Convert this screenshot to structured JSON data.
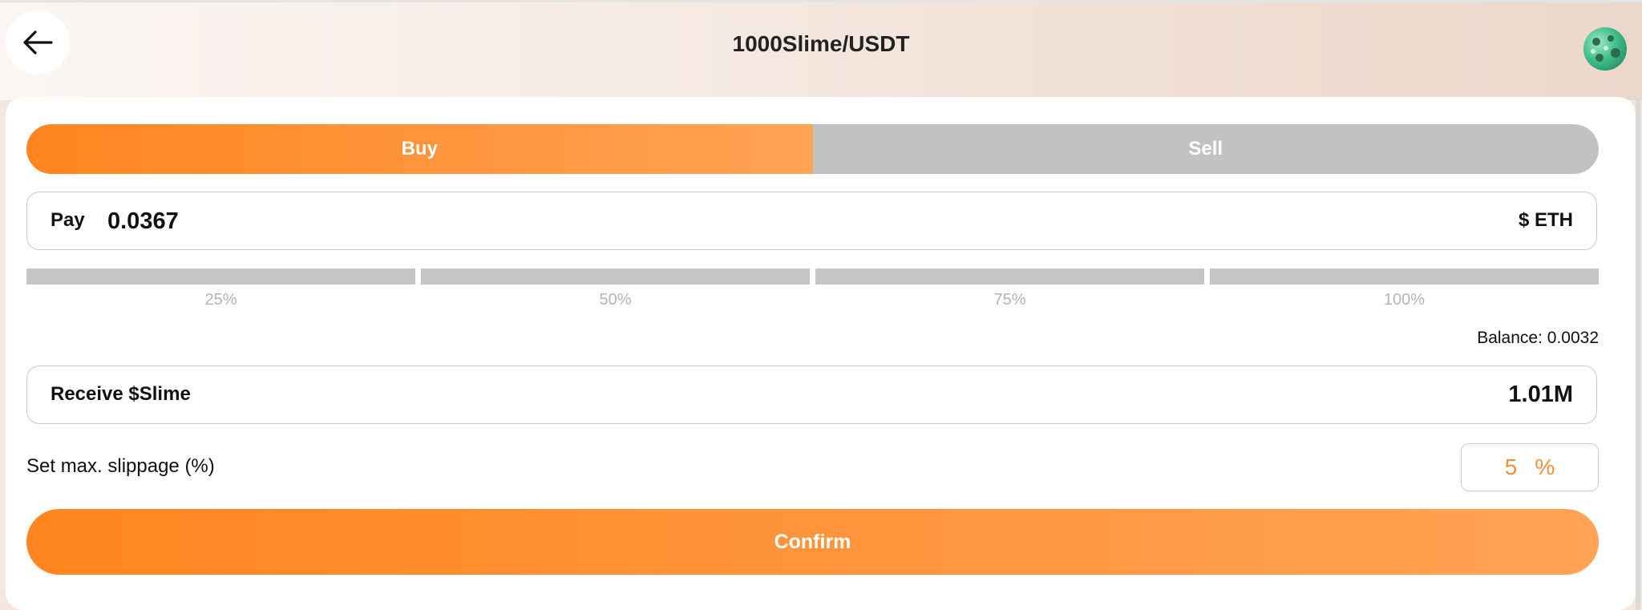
{
  "header": {
    "title": "1000Slime/USDT",
    "back_icon": "arrow-left-icon",
    "avatar_icon": "slime-token-avatar"
  },
  "tabs": [
    {
      "label": "Buy",
      "active": true
    },
    {
      "label": "Sell",
      "active": false
    }
  ],
  "pay": {
    "label": "Pay",
    "value": "0.0367",
    "currency": "$ ETH"
  },
  "percent_options": [
    "25%",
    "50%",
    "75%",
    "100%"
  ],
  "balance": "Balance: 0.0032",
  "receive": {
    "label": "Receive $Slime",
    "value": "1.01M"
  },
  "slippage": {
    "label": "Set max. slippage (%)",
    "value": "5",
    "unit": "%"
  },
  "confirm_label": "Confirm",
  "colors": {
    "accent_start": "#ff8520",
    "accent_end": "#ffa355",
    "inactive": "#c2c2c2",
    "slippage_text": "#f0913a"
  }
}
